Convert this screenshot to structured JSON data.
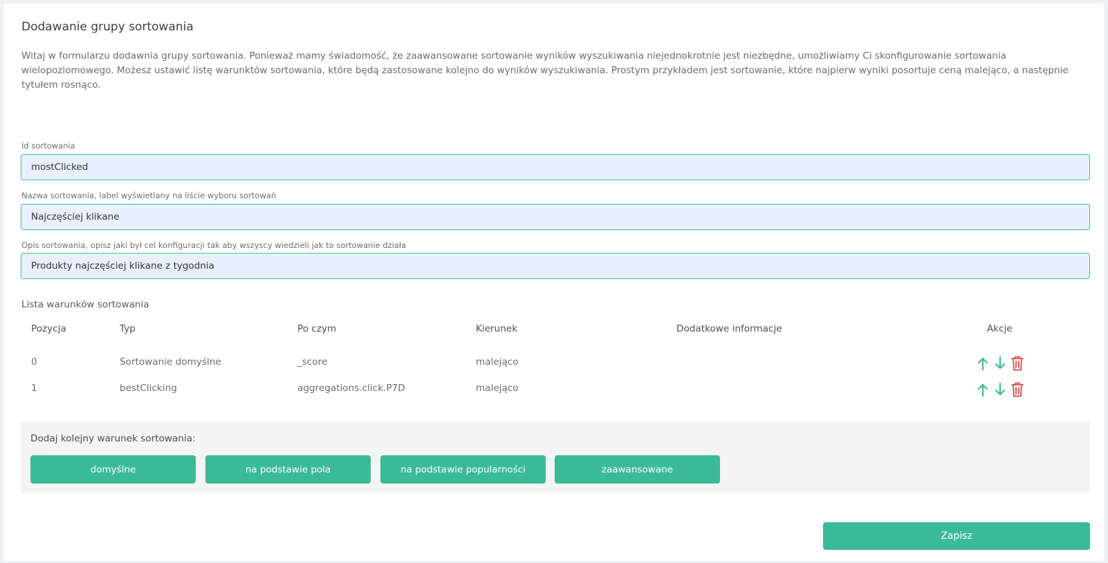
{
  "page": {
    "title": "Dodawanie grupy sortowania",
    "intro": "Witaj w formularzu dodawnia grupy sortowania. Ponieważ mamy świadomość, że zaawansowane sortowanie wyników wyszukiwania niejednokrotnie jest niezbędne, umożliwiamy Ci skonfigurowanie sortowania wielopoziomowego. Możesz ustawić listę warunktów sortowania, które będą zastosowane kolejno do wyników wyszukiwania. Prostym przykładem jest sortowanie, które najpierw wyniki posortuje ceną malejąco, a następnie tytułem rosnąco."
  },
  "form": {
    "id": {
      "label": "Id sortowania",
      "value": "mostClicked"
    },
    "name": {
      "label": "Nazwa sortowania, label wyświetlany na liście wyboru sortowań",
      "value": "Najczęściej klikane"
    },
    "description": {
      "label": "Opis sortowania, opisz jaki był cel konfiguracji tak aby wszyscy wiedzieli jak to sortowanie działa",
      "value": "Produkty najczęściej klikane z tygodnia"
    }
  },
  "conditions": {
    "label": "Lista warunków sortowania",
    "columns": [
      "Pozycja",
      "Typ",
      "Po czym",
      "Kierunek",
      "Dodatkowe informacje",
      "Akcje"
    ],
    "rows": [
      {
        "position": "0",
        "type": "Sortowanie domyślne",
        "field": "_score",
        "direction": "malejąco",
        "info": ""
      },
      {
        "position": "1",
        "type": "bestClicking",
        "field": "aggregations.click.P7D",
        "direction": "malejąco",
        "info": ""
      }
    ]
  },
  "add": {
    "label": "Dodaj kolejny warunek sortowania:",
    "buttons": [
      "domyślne",
      "na podstawie pola",
      "na podstawie popularności",
      "zaawansowane"
    ]
  },
  "save_label": "Zapisz",
  "colors": {
    "accent": "#3bba98",
    "danger": "#e0444b",
    "input_bg": "#e8f0fe",
    "input_border": "#3fbf93"
  },
  "icons": {
    "move_up": "arrow-up-icon",
    "move_down": "arrow-down-icon",
    "delete": "trash-icon"
  }
}
